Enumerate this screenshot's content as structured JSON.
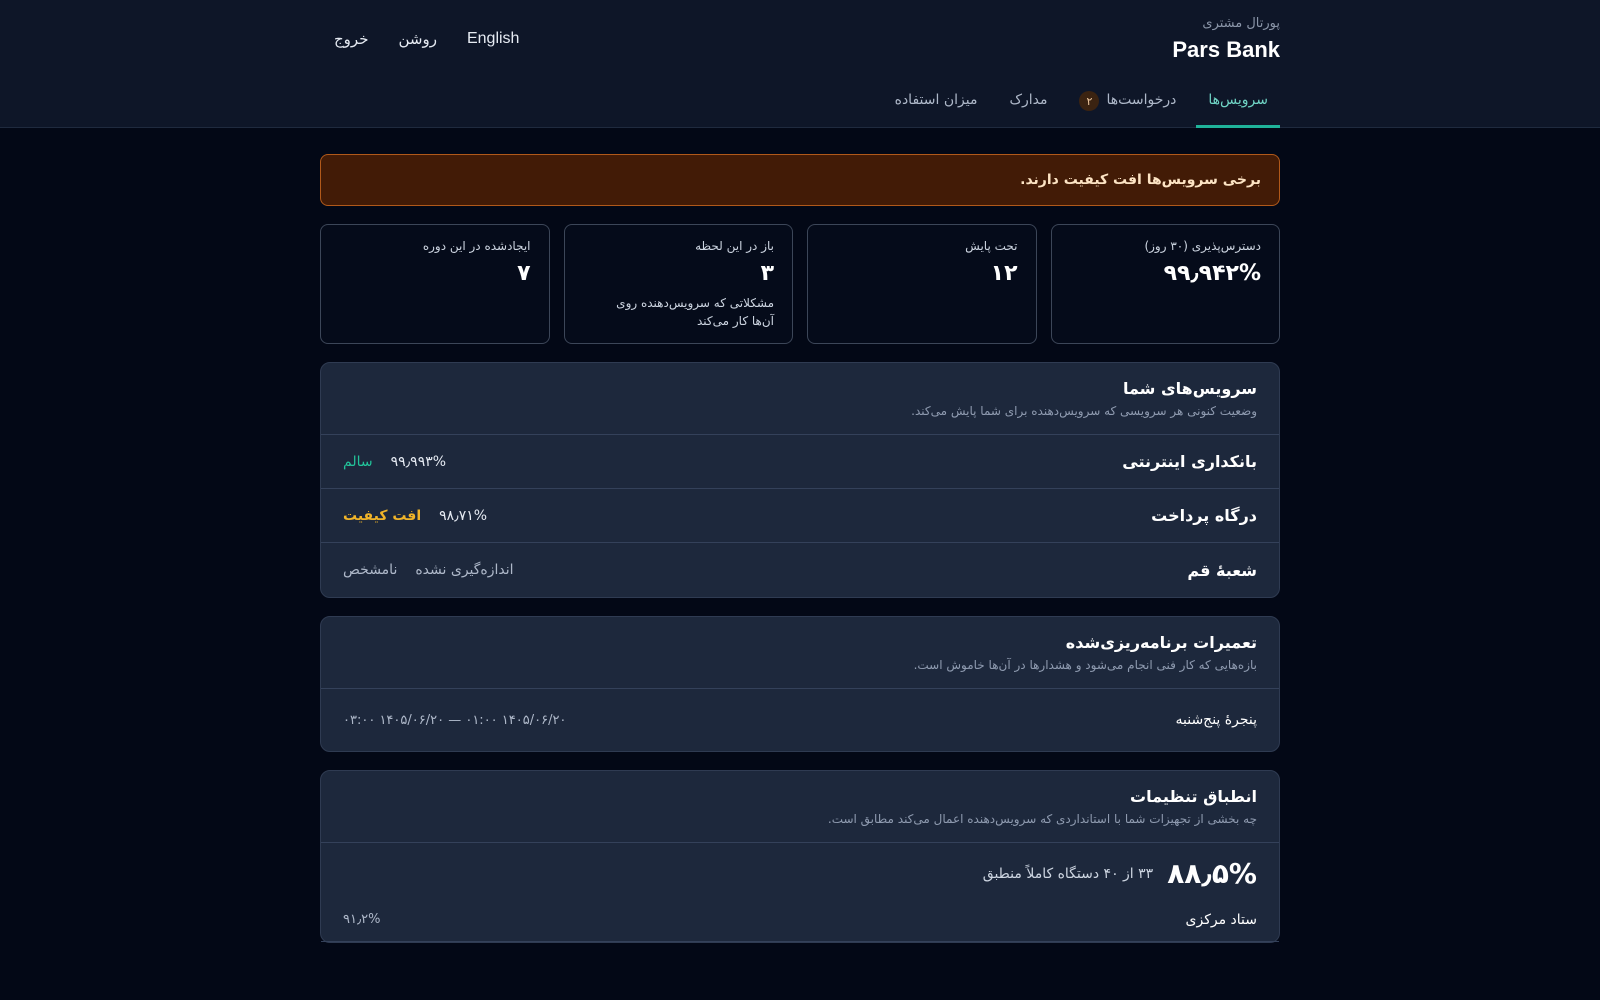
{
  "header": {
    "portal_label": "پورتال مشتری",
    "brand": "Pars Bank",
    "links": {
      "language": "English",
      "theme": "روشن",
      "logout": "خروج"
    },
    "tabs": [
      {
        "label": "سرویس‌ها",
        "active": true
      },
      {
        "label": "درخواست‌ها",
        "badge": "۲"
      },
      {
        "label": "مدارک"
      },
      {
        "label": "میزان استفاده"
      }
    ]
  },
  "banner": {
    "text": "برخی سرویس‌ها افت کیفیت دارند.",
    "color": "#421b06",
    "border": "#b1591a"
  },
  "stats": [
    {
      "label": "دسترس‌پذیری (۳۰ روز)",
      "value": "۹۹٫۹۴۲%"
    },
    {
      "label": "تحت پایش",
      "value": "۱۲"
    },
    {
      "label": "باز در این لحظه",
      "value": "۳",
      "note": "مشکلاتی که سرویس‌دهنده روی آن‌ها کار می‌کند"
    },
    {
      "label": "ایجادشده در این دوره",
      "value": "۷"
    }
  ],
  "services_card": {
    "title": "سرویس‌های شما",
    "subtitle": "وضعیت کنونی هر سرویسی که سرویس‌دهنده برای شما پایش می‌کند.",
    "rows": [
      {
        "name": "بانکداری اینترنتی",
        "value": "۹۹٫۹۹۳%",
        "status": "سالم",
        "status_color": "#22c39a"
      },
      {
        "name": "درگاه پرداخت",
        "value": "۹۸٫۷۱%",
        "status": "افت کیفیت",
        "status_color": "#f0b429"
      },
      {
        "name": "شعبهٔ قم",
        "value": "اندازه‌گیری نشده",
        "status": "نامشخص",
        "status_color": "#aeb8c9"
      }
    ]
  },
  "maintenance_card": {
    "title": "تعمیرات برنامه‌ریزی‌شده",
    "subtitle": "بازه‌هایی که کار فنی انجام می‌شود و هشدارها در آن‌ها خاموش است.",
    "rows": [
      {
        "name": "پنجرهٔ پنج‌شنبه",
        "range": "۱۴۰۵/۰۶/۲۰ ۰۱:۰۰ — ۱۴۰۵/۰۶/۲۰ ۰۳:۰۰"
      }
    ]
  },
  "compliance_card": {
    "title": "انطباق تنظیمات",
    "subtitle": "چه بخشی از تجهیزات شما با استانداردی که سرویس‌دهنده اعمال می‌کند مطابق است.",
    "percent": "۸۸٫۵%",
    "summary": "۳۳ از ۴۰ دستگاه کاملاً منطبق",
    "rows": [
      {
        "name": "ستاد مرکزی",
        "value": "۹۱٫۲%"
      }
    ]
  }
}
